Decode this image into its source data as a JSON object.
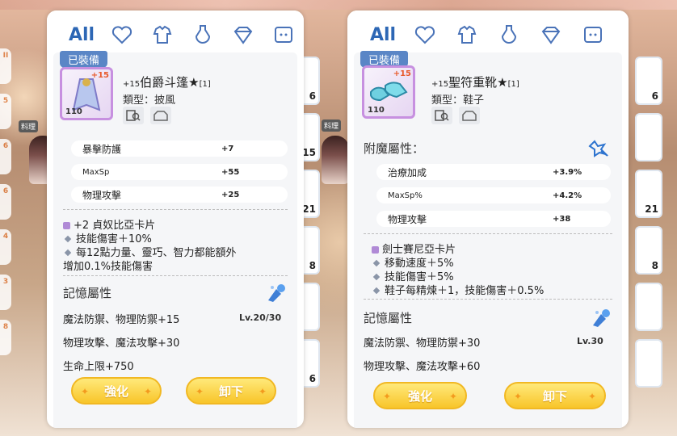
{
  "left_panel": {
    "tabs": {
      "all_label": "All"
    },
    "equipped_tag": "已裝備",
    "item": {
      "plus": "+15",
      "level": "110",
      "name_prefix": "+15",
      "name": "伯爵斗篷★",
      "name_suffix": "[1]",
      "type_label": "類型：披風"
    },
    "stats": [
      {
        "name": "暴擊防護",
        "value": "+7"
      },
      {
        "name": "MaxSp",
        "value": "+55"
      },
      {
        "name": "物理攻擊",
        "value": "+25"
      }
    ],
    "card_lines": [
      "+2 貞奴比亞卡片",
      "技能傷害＋10%",
      "每12點力量、靈巧、智力都能額外",
      "增加0.1%技能傷害"
    ],
    "memory_title": "記憶屬性",
    "memory": [
      {
        "text": "魔法防禦、物理防禦+15",
        "level": "Lv.20/30"
      },
      {
        "text": "物理攻擊、魔法攻擊+30",
        "level": ""
      },
      {
        "text": "生命上限+750",
        "level": ""
      }
    ],
    "buttons": {
      "enhance": "強化",
      "unequip": "卸下"
    }
  },
  "right_panel": {
    "tabs": {
      "all_label": "All"
    },
    "equipped_tag": "已裝備",
    "item": {
      "plus": "+15",
      "level": "110",
      "name_prefix": "+15",
      "name": "聖符重靴★",
      "name_suffix": "[1]",
      "type_label": "類型：鞋子"
    },
    "enchant_title": "附魔屬性：",
    "stats": [
      {
        "name": "治療加成",
        "value": "+3.9%"
      },
      {
        "name": "MaxSp%",
        "value": "+4.2%"
      },
      {
        "name": "物理攻擊",
        "value": "+38"
      }
    ],
    "card_lines": [
      "劍士賽尼亞卡片",
      "移動速度＋5%",
      "技能傷害＋5%",
      "鞋子每精煉＋1，技能傷害＋0.5%"
    ],
    "memory_title": "記憶屬性",
    "memory": [
      {
        "text": "魔法防禦、物理防禦+30",
        "level": "Lv.30"
      },
      {
        "text": "物理攻擊、魔法攻擊+60",
        "level": ""
      }
    ],
    "buttons": {
      "enhance": "強化",
      "unequip": "卸下"
    }
  },
  "background": {
    "gutter_badge": "料理",
    "left_tab_numbers": [
      "II",
      "5",
      "6",
      "6",
      "4",
      "3",
      "8"
    ],
    "inventory_counts_left": [
      "6",
      "15",
      "21",
      "8",
      "",
      "6",
      "6"
    ],
    "inventory_counts_right": [
      "6",
      "",
      "21",
      "8",
      "",
      "",
      "6"
    ]
  },
  "colors": {
    "accent_blue": "#2d67b5",
    "button_yellow": "#f8c52a",
    "rarity_purple": "#c790e0"
  }
}
